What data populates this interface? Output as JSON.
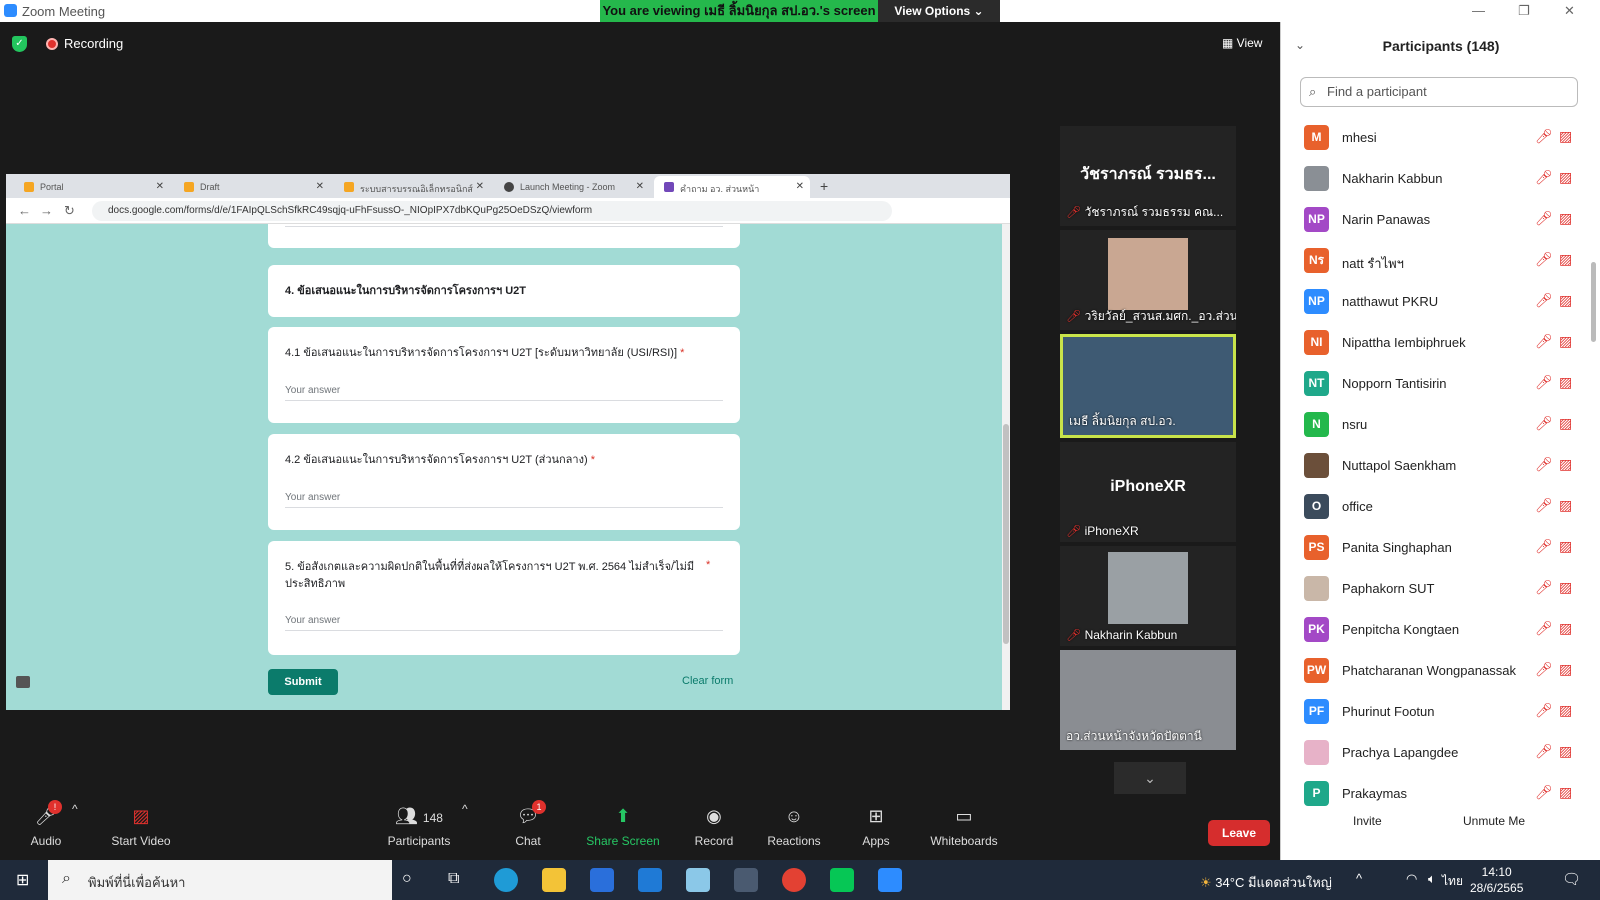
{
  "window": {
    "title": "Zoom Meeting",
    "controls": [
      "—",
      "❐",
      "✕"
    ]
  },
  "banner": {
    "viewing": "You are viewing เมธี ลิ้มนิยกุล สป.อว.'s screen",
    "view_options": "View Options ⌄"
  },
  "meeting": {
    "recording": "Recording",
    "view_label": "View"
  },
  "browser": {
    "tabs": [
      {
        "label": "Portal",
        "close": "✕"
      },
      {
        "label": "Draft",
        "close": "✕"
      },
      {
        "label": "ระบบสารบรรณอิเล็กทรอนิกส์",
        "close": "✕"
      },
      {
        "label": "Launch Meeting - Zoom",
        "close": "✕"
      },
      {
        "label": "คำถาม อว. ส่วนหน้า",
        "close": "✕"
      }
    ],
    "new_tab": "+",
    "url": "docs.google.com/forms/d/e/1FAIpQLSchSfkRC49sqjq-uFhFsussO-_NIOpIPX7dbKQuPg25OeDSzQ/viewform"
  },
  "form": {
    "section_title": "4. ข้อเสนอแนะในการบริหารจัดการโครงการฯ U2T",
    "q41": "4.1 ข้อเสนอแนะในการบริหารจัดการโครงการฯ U2T [ระดับมหาวิทยาลัย (USI/RSI)]",
    "q42": "4.2 ข้อเสนอแนะในการบริหารจัดการโครงการฯ U2T (ส่วนกลาง)",
    "q5": "5. ข้อสังเกตและความผิดปกติในพื้นที่ที่ส่งผลให้โครงการฯ U2T พ.ศ. 2564 ไม่สำเร็จ/ไม่มีประสิทธิภาพ",
    "required_mark": "*",
    "answer_placeholder": "Your answer",
    "submit": "Submit",
    "clear": "Clear form"
  },
  "videos": [
    {
      "name": "วัชราภรณ์ รวมธรรม คณ...",
      "display": "วัชราภรณ์ รวมธร..."
    },
    {
      "name": "วริยวัลย์_สวนส.มศก._อว.ส่วน..."
    },
    {
      "name": "เมธี ลิ้มนิยกุล สป.อว."
    },
    {
      "name": "iPhoneXR",
      "display": "iPhoneXR"
    },
    {
      "name": "Nakharin Kabbun"
    },
    {
      "name": "อว.ส่วนหน้าจังหวัดปัตตานี"
    }
  ],
  "toolbar": {
    "audio": "Audio",
    "start_video": "Start Video",
    "participants": "Participants",
    "participants_count": "148",
    "chat": "Chat",
    "chat_badge": "1",
    "audio_badge": "!",
    "share": "Share Screen",
    "record": "Record",
    "reactions": "Reactions",
    "apps": "Apps",
    "whiteboards": "Whiteboards",
    "leave": "Leave"
  },
  "panel": {
    "title": "Participants (148)",
    "search_placeholder": "Find a participant",
    "participants": [
      {
        "initials": "M",
        "name": "mhesi",
        "color": "#e8612c"
      },
      {
        "initials": "",
        "name": "Nakharin Kabbun",
        "color": "#8a8f95"
      },
      {
        "initials": "NP",
        "name": "Narin Panawas",
        "color": "#a349c6"
      },
      {
        "initials": "Nร",
        "name": "natt รำไพฯ",
        "color": "#e8612c"
      },
      {
        "initials": "NP",
        "name": "natthawut PKRU",
        "color": "#2d8cff"
      },
      {
        "initials": "NI",
        "name": "Nipattha Iembiphruek",
        "color": "#e8612c"
      },
      {
        "initials": "NT",
        "name": "Nopporn Tantisirin",
        "color": "#1fa88a"
      },
      {
        "initials": "N",
        "name": "nsru",
        "color": "#23b84c"
      },
      {
        "initials": "",
        "name": "Nuttapol Saenkham",
        "color": "#6b4f3a"
      },
      {
        "initials": "O",
        "name": "office",
        "color": "#3b4b5c"
      },
      {
        "initials": "PS",
        "name": "Panita Singhaphan",
        "color": "#e8612c"
      },
      {
        "initials": "",
        "name": "Paphakorn SUT",
        "color": "#c9b7a8"
      },
      {
        "initials": "PK",
        "name": "Penpitcha Kongtaen",
        "color": "#a349c6"
      },
      {
        "initials": "PW",
        "name": "Phatcharanan Wongpanassak",
        "color": "#e8612c"
      },
      {
        "initials": "PF",
        "name": "Phurinut Footun",
        "color": "#2d8cff"
      },
      {
        "initials": "",
        "name": "Prachya Lapangdee",
        "color": "#e7b2c8"
      },
      {
        "initials": "P",
        "name": "Prakaymas",
        "color": "#1fa88a"
      }
    ],
    "invite": "Invite",
    "unmute": "Unmute Me"
  },
  "taskbar": {
    "search": "พิมพ์ที่นี่เพื่อค้นหา",
    "weather": "34°C  มีแดดส่วนใหญ่",
    "lang": "ไทย",
    "time": "14:10",
    "date": "28/6/2565"
  }
}
